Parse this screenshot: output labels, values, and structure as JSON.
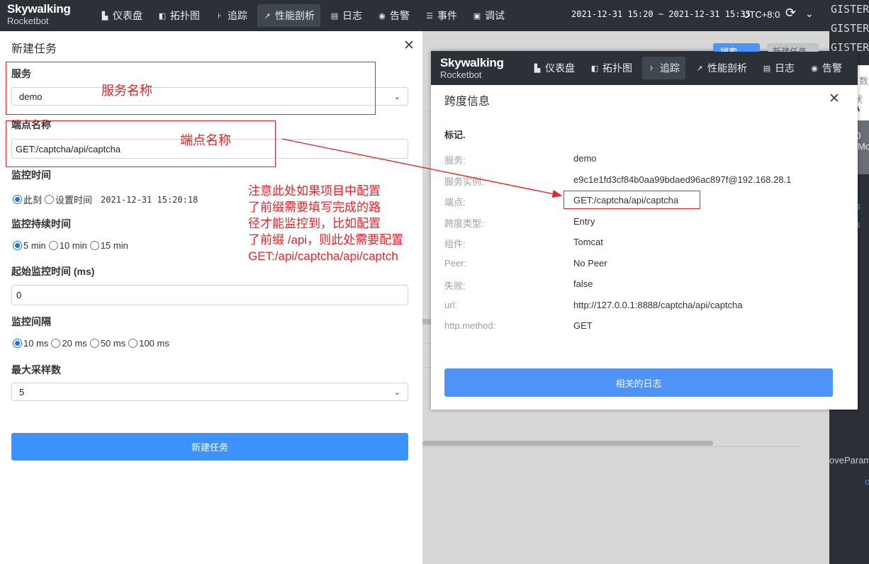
{
  "app": {
    "brand": "Skywalking",
    "sub": "Rocketbot",
    "nav": [
      {
        "icon": "dashboard-icon",
        "glyph": "▙",
        "label": "仪表盘"
      },
      {
        "icon": "topology-icon",
        "glyph": "◧",
        "label": "拓扑图"
      },
      {
        "icon": "trace-icon",
        "glyph": "⊦",
        "label": "追踪"
      },
      {
        "icon": "profile-icon",
        "glyph": "↗",
        "label": "性能剖析"
      },
      {
        "icon": "log-icon",
        "glyph": "▤",
        "label": "日志"
      },
      {
        "icon": "alarm-icon",
        "glyph": "◉",
        "label": "告警"
      },
      {
        "icon": "event-icon",
        "glyph": "☰",
        "label": "事件"
      },
      {
        "icon": "debug-icon",
        "glyph": "▣",
        "label": "调试"
      }
    ],
    "time_range": "2021-12-31 15:20 ~ 2021-12-31 15:35",
    "timezone": "UTC+8:0"
  },
  "terminal": {
    "lines": [
      "GISTER",
      "GISTER",
      "GISTER"
    ],
    "bits": [
      "数",
      "状",
      "A",
      "20",
      "Mo",
      "164",
      "118",
      "oveParam",
      "o"
    ]
  },
  "drawer": {
    "title": "新建任务",
    "service_label": "服务",
    "service_value": "demo",
    "endpoint_label": "端点名称",
    "endpoint_value": "GET:/captcha/api/captcha",
    "monitor_time_label": "监控时间",
    "monitor_time_options": [
      "此刻",
      "设置时间"
    ],
    "monitor_time_value": "2021-12-31 15:20:18",
    "duration_label": "监控持续时间",
    "duration_options": [
      "5 min",
      "10 min",
      "15 min"
    ],
    "start_label": "起始监控时间 (ms)",
    "start_value": "0",
    "interval_label": "监控间隔",
    "interval_options": [
      "10 ms",
      "20 ms",
      "50 ms",
      "100 ms"
    ],
    "samples_label": "最大采样数",
    "samples_value": "5",
    "submit_label": "新建任务"
  },
  "annotations": {
    "service_name": "服务名称",
    "endpoint_name": "端点名称",
    "note_lines": [
      "注意此处如果项目中配置",
      "了前缀需要填写完成的路",
      "径才能监控到，比如配置",
      "了前缀 /api，则此处需要配置",
      "GET:/api/captcha/api/captch"
    ]
  },
  "span_window": {
    "nav": [
      {
        "icon": "dashboard-icon",
        "glyph": "▙",
        "label": "仪表盘"
      },
      {
        "icon": "topology-icon",
        "glyph": "◧",
        "label": "拓扑图"
      },
      {
        "icon": "trace-icon",
        "glyph": "⊦",
        "label": "追踪"
      },
      {
        "icon": "profile-icon",
        "glyph": "↗",
        "label": "性能剖析"
      },
      {
        "icon": "log-icon",
        "glyph": "▤",
        "label": "日志"
      },
      {
        "icon": "alarm-icon",
        "glyph": "◉",
        "label": "告警"
      }
    ],
    "behind_buttons": [
      "搜索",
      "新建任务"
    ],
    "title": "跨度信息",
    "section": "标记.",
    "rows": [
      {
        "key": "服务:",
        "value": "demo"
      },
      {
        "key": "服务实例:",
        "value": "e9c1e1fd3cf84b0aa99bdaed96ac897f@192.168.28.1"
      },
      {
        "key": "端点:",
        "value": "GET:/captcha/api/captcha"
      },
      {
        "key": "跨度类型:",
        "value": "Entry"
      },
      {
        "key": "组件:",
        "value": "Tomcat"
      },
      {
        "key": "Peer:",
        "value": "No Peer"
      },
      {
        "key": "失败:",
        "value": "false"
      },
      {
        "key": "url:",
        "value": "http://127.0.0.1:8888/captcha/api/captcha"
      },
      {
        "key": "http.method:",
        "value": "GET"
      }
    ],
    "button": "相关的日志"
  },
  "colors": {
    "accent": "#3d92fb",
    "annotation": "#e3242b",
    "nav_bg": "#2b3137"
  }
}
